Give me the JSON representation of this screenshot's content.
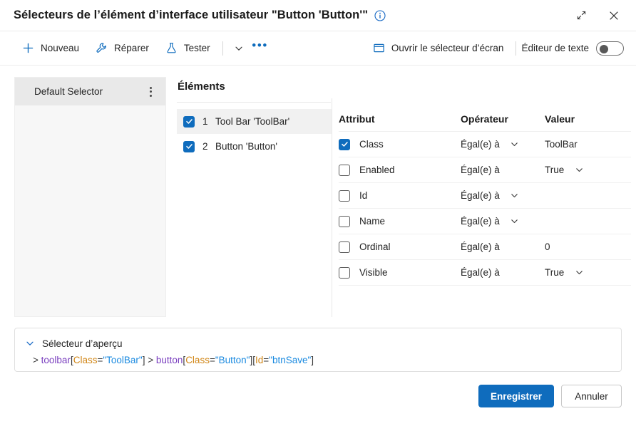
{
  "window": {
    "title": "Sélecteurs de l’élément d’interface utilisateur \"Button 'Button'\"",
    "info_icon": "info-circle-icon",
    "expand_icon": "expand-icon",
    "close_icon": "close-icon"
  },
  "toolbar": {
    "new_label": "Nouveau",
    "repair_label": "Réparer",
    "test_label": "Tester",
    "more_chevron": "chevron-down-icon",
    "overflow": "ellipsis-icon",
    "open_screen_selector_label": "Ouvrir le sélecteur d’écran",
    "text_editor_label": "Éditeur de texte",
    "text_editor_toggle_state": "off"
  },
  "left_panel": {
    "items": [
      {
        "label": "Default Selector",
        "selected": true,
        "menu_icon": "vertical-ellipsis-icon"
      }
    ]
  },
  "elements": {
    "title": "Éléments",
    "items": [
      {
        "index": "1",
        "label": "Tool Bar 'ToolBar'",
        "checked": true,
        "selected": true
      },
      {
        "index": "2",
        "label": "Button 'Button'",
        "checked": true,
        "selected": false
      }
    ]
  },
  "attributes": {
    "headers": {
      "attribute": "Attribut",
      "operator": "Opérateur",
      "value": "Valeur"
    },
    "rows": [
      {
        "name": "Class",
        "checked": true,
        "operator": "Égal(e) à",
        "operator_chevron": true,
        "value": "ToolBar",
        "value_chevron": false
      },
      {
        "name": "Enabled",
        "checked": false,
        "operator": "Égal(e) à",
        "operator_chevron": false,
        "value": "True",
        "value_chevron": true
      },
      {
        "name": "Id",
        "checked": false,
        "operator": "Égal(e) à",
        "operator_chevron": true,
        "value": "",
        "value_chevron": false
      },
      {
        "name": "Name",
        "checked": false,
        "operator": "Égal(e) à",
        "operator_chevron": true,
        "value": "",
        "value_chevron": false
      },
      {
        "name": "Ordinal",
        "checked": false,
        "operator": "Égal(e) à",
        "operator_chevron": false,
        "value": "0",
        "value_chevron": false
      },
      {
        "name": "Visible",
        "checked": false,
        "operator": "Égal(e) à",
        "operator_chevron": false,
        "value": "True",
        "value_chevron": true
      }
    ]
  },
  "preview": {
    "title": "Sélecteur d’aperçu",
    "expand_icon": "chevron-down-icon",
    "tokens": [
      {
        "t": ">",
        "k": "gt"
      },
      {
        "t": " ",
        "k": "gt"
      },
      {
        "t": "toolbar",
        "k": "tag"
      },
      {
        "t": "[",
        "k": "brk"
      },
      {
        "t": "Class",
        "k": "attr"
      },
      {
        "t": "=",
        "k": "eq"
      },
      {
        "t": "\"ToolBar\"",
        "k": "str"
      },
      {
        "t": "]",
        "k": "brk"
      },
      {
        "t": " > ",
        "k": "gt"
      },
      {
        "t": "button",
        "k": "tag"
      },
      {
        "t": "[",
        "k": "brk"
      },
      {
        "t": "Class",
        "k": "attr"
      },
      {
        "t": "=",
        "k": "eq"
      },
      {
        "t": "\"Button\"",
        "k": "str"
      },
      {
        "t": "]",
        "k": "brk"
      },
      {
        "t": "[",
        "k": "brk"
      },
      {
        "t": "Id",
        "k": "attr"
      },
      {
        "t": "=",
        "k": "eq"
      },
      {
        "t": "\"btnSave\"",
        "k": "str"
      },
      {
        "t": "]",
        "k": "brk"
      }
    ],
    "plain_text": "> toolbar[Class=\"ToolBar\"] > button[Class=\"Button\"][Id=\"btnSave\"]"
  },
  "footer": {
    "save_label": "Enregistrer",
    "cancel_label": "Annuler"
  },
  "colors": {
    "accent": "#0f6cbd",
    "toolbar_icon": "#0f6cbd",
    "panel_bg": "#f7f7f7",
    "selected_row": "#f1f1f1",
    "selector_item_bg": "#e9e9e9",
    "border": "#e0e0e0",
    "token_tag": "#7a3fbf",
    "token_attr": "#d18616",
    "token_string": "#1a8ae0"
  }
}
